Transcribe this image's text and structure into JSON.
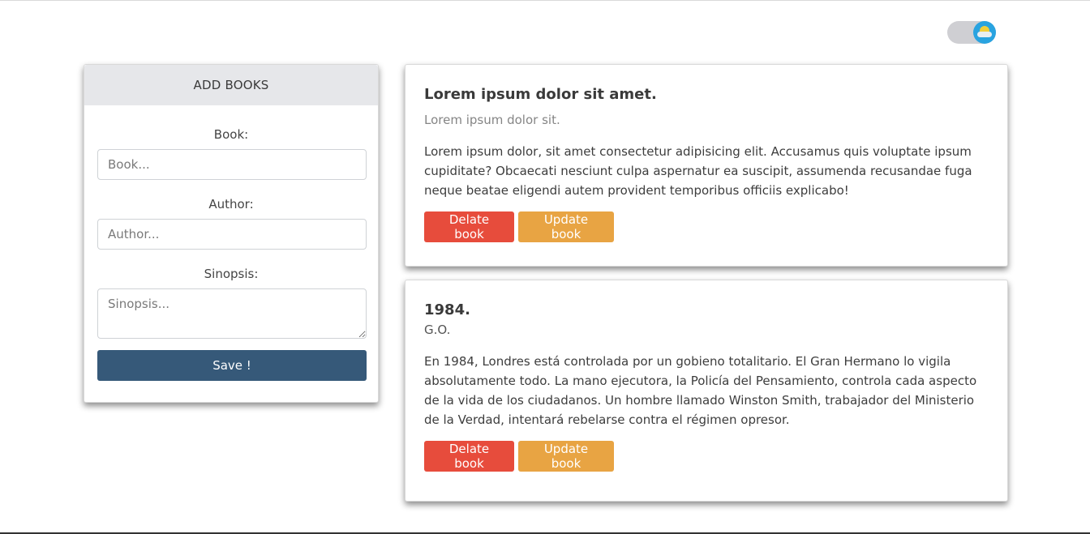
{
  "add_form": {
    "header": "ADD BOOKS",
    "book_label": "Book:",
    "book_placeholder": "Book...",
    "author_label": "Author:",
    "author_placeholder": "Author...",
    "synopsis_label": "Sinopsis:",
    "synopsis_placeholder": "Sinopsis...",
    "save_label": "Save !"
  },
  "books": [
    {
      "title": "Lorem ipsum dolor sit amet.",
      "author": "Lorem ipsum dolor sit.",
      "synopsis": "Lorem ipsum dolor, sit amet consectetur adipisicing elit. Accusamus quis voluptate ipsum cupiditate? Obcaecati nesciunt culpa aspernatur ea suscipit, assumenda recusandae fuga neque beatae eligendi autem provident temporibus officiis explicabo!",
      "delete_label": "Delate book",
      "update_label": "Update book"
    },
    {
      "title": "1984.",
      "author": "G.O.",
      "synopsis": "En 1984, Londres está controlada por un gobieno totalitario. El Gran Hermano lo vigila absolutamente todo. La mano ejecutora, la Policía del Pensamiento, controla cada aspecto de la vida de los ciudadanos. Un hombre llamado Winston Smith, trabajador del Ministerio de la Verdad, intentará rebelarse contra el régimen opresor.",
      "delete_label": "Delate book",
      "update_label": "Update book"
    }
  ],
  "theme_toggle": {
    "icon": "sun-cloud-icon"
  },
  "colors": {
    "save": "#365979",
    "delete": "#e74c3c",
    "update": "#e8a443",
    "header_bg": "#e6e7ea"
  }
}
